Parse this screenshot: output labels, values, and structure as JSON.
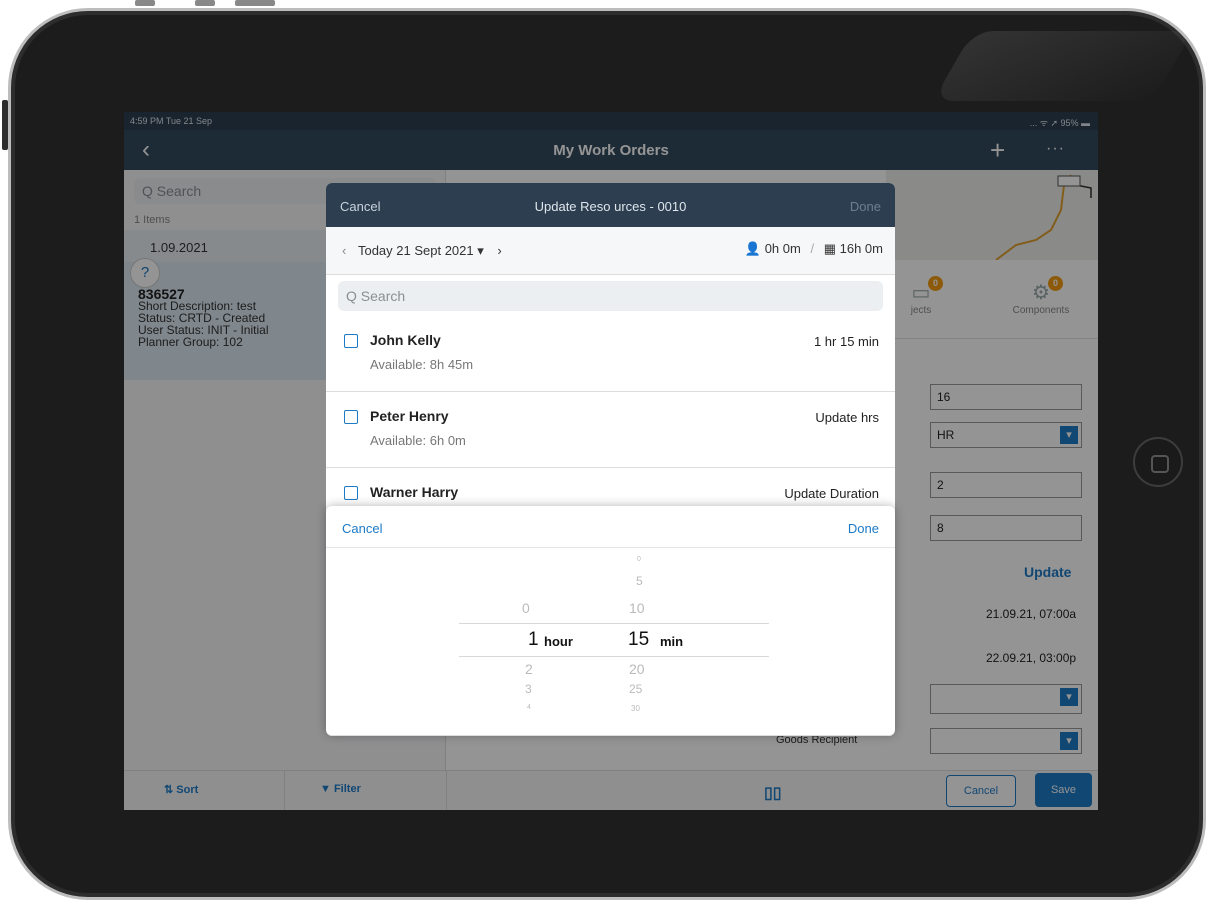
{
  "status": {
    "time": "4:59 PM  Tue 21 Sep",
    "right": "... ᯤ ➚ 95% ▬"
  },
  "nav": {
    "title": "My Work Orders",
    "back_icon": "‹",
    "plus_icon": "+",
    "more_icon": "···"
  },
  "master": {
    "search_placeholder": "Q  Search",
    "items_count": "1 Items",
    "date_header": "1.09.2021",
    "help_icon": "?",
    "card": {
      "number": "836527",
      "short_description": "Short Description: test",
      "status": "Status: CRTD - Created",
      "user_status": "User Status: INIT - Initial",
      "planner_group": "Planner Group: 102"
    }
  },
  "detail": {
    "tabs": [
      {
        "label": "jects",
        "badge": "0"
      },
      {
        "label": "Components",
        "badge": "0"
      }
    ],
    "fields": [
      "16",
      "HR",
      "2",
      "8"
    ],
    "update_label": "Update",
    "start_datetime": "21.09.21,  07:00a",
    "end_datetime": "22.09.21,  03:00p",
    "goods_recipient_label": "Goods Recipient"
  },
  "toolbar": {
    "sort": "Sort",
    "filter": "Filter",
    "cancel": "Cancel",
    "save": "Save"
  },
  "modal": {
    "cancel": "Cancel",
    "title": "Update Reso urces - 0010",
    "done": "Done",
    "date_nav": "Today 21 Sept 2021 ▾",
    "prev_icon": "‹",
    "next_icon": "›",
    "assigned": "0h 0m",
    "total": "16h 0m",
    "search_placeholder": "Q  Search",
    "resources": [
      {
        "name": "John Kelly",
        "available": "Available: 8h 45m",
        "time": "1 hr 15 min"
      },
      {
        "name": "Peter Henry",
        "available": "Available: 6h 0m",
        "time": "Update hrs"
      },
      {
        "name": "Warner Harry",
        "available": "",
        "time": "Update Duration"
      }
    ]
  },
  "picker": {
    "cancel": "Cancel",
    "done": "Done",
    "hours": {
      "above": [
        "0"
      ],
      "selected": "1",
      "unit": "hour",
      "below": [
        "2",
        "3",
        "4"
      ]
    },
    "minutes": {
      "above": [
        "0",
        "5",
        "10"
      ],
      "selected": "15",
      "unit": "min",
      "below": [
        "20",
        "25",
        "30"
      ]
    }
  }
}
